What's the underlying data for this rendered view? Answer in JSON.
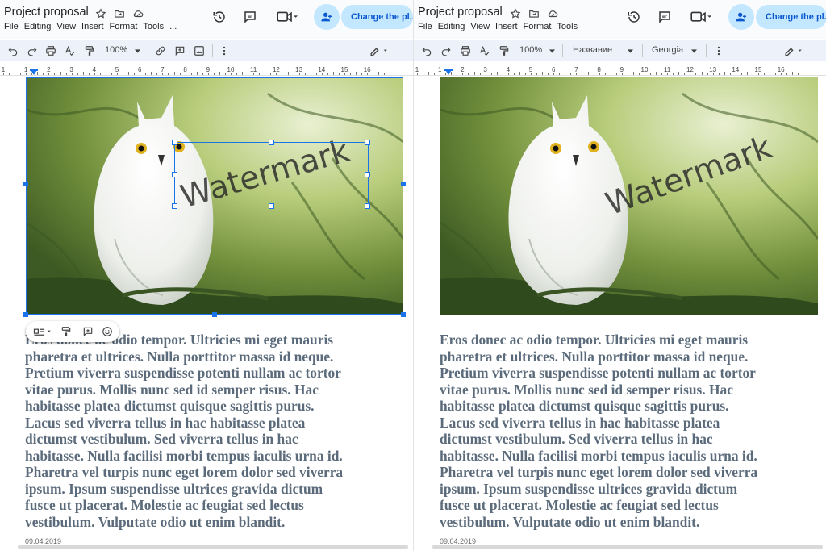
{
  "doc": {
    "title": "Project proposal"
  },
  "menu": [
    "File",
    "Editing",
    "View",
    "Insert",
    "Format",
    "Tools",
    "..."
  ],
  "share": {
    "label": "Change the pl..."
  },
  "toolbar": {
    "zoom": "100%",
    "style": "Название",
    "font": "Georgia"
  },
  "ruler": {
    "numbers": [
      "1",
      "1",
      "2",
      "3",
      "4",
      "5",
      "6",
      "7",
      "8",
      "9",
      "10",
      "11",
      "12",
      "13",
      "14",
      "15",
      "16"
    ]
  },
  "image": {
    "watermark": "Watermark"
  },
  "body": {
    "lines": [
      "Eros donec ac odio tempor. Ultricies mi eget mauris",
      "pharetra et ultrices. Nulla porttitor massa id neque.",
      "Pretium viverra suspendisse potenti nullam ac tortor",
      "vitae purus. Mollis nunc sed id semper risus. Hac",
      "habitasse platea dictumst quisque sagittis purus.",
      "Lacus sed viverra tellus in hac habitasse platea",
      "dictumst vestibulum. Sed viverra tellus in hac",
      "habitasse. Nulla facilisi morbi tempus iaculis urna id.",
      "Pharetra vel turpis nunc eget lorem dolor sed viverra",
      "ipsum. Ipsum suspendisse ultrices gravida dictum",
      "fusce ut placerat. Molestie ac feugiat sed lectus",
      "vestibulum. Vulputate odio ut enim blandit."
    ]
  },
  "footer": {
    "date": "09.04.2019"
  },
  "colors": {
    "accent": "#1a73e8",
    "share_bg": "#c2e7ff",
    "share_text": "#0b57d0",
    "body_text": "#5b6b7b"
  },
  "icons": [
    "star-icon",
    "folder-move-icon",
    "cloud-status-icon",
    "history-icon",
    "comments-icon",
    "video-call-icon",
    "share-person-icon",
    "undo-icon",
    "redo-icon",
    "print-icon",
    "spellcheck-icon",
    "paint-format-icon",
    "insert-link-icon",
    "add-comment-icon",
    "insert-image-icon",
    "more-vert-icon",
    "edit-mode-pencil-icon",
    "wrap-text-icon",
    "emoji-icon"
  ]
}
